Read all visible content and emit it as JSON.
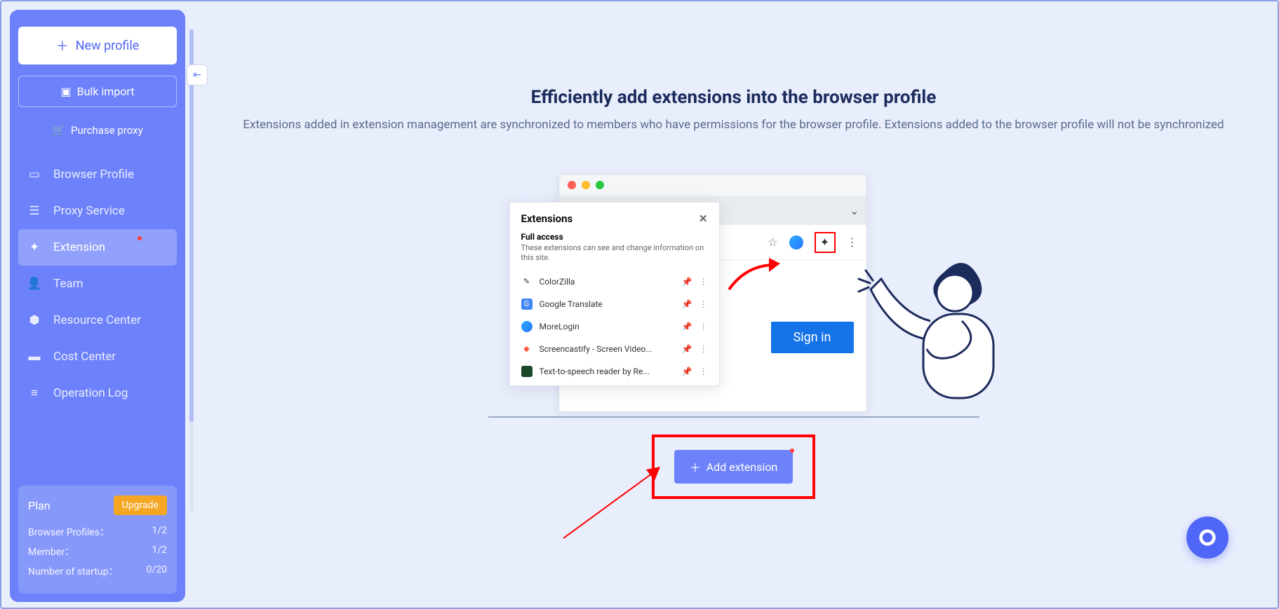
{
  "sidebar": {
    "new_profile": "New profile",
    "bulk_import": "Bulk import",
    "purchase_proxy": "Purchase proxy",
    "items": [
      {
        "label": "Browser Profile"
      },
      {
        "label": "Proxy Service"
      },
      {
        "label": "Extension"
      },
      {
        "label": "Team"
      },
      {
        "label": "Resource Center"
      },
      {
        "label": "Cost Center"
      },
      {
        "label": "Operation Log"
      }
    ],
    "plan": {
      "title": "Plan",
      "upgrade": "Upgrade",
      "profiles_label": "Browser Profiles：",
      "profiles_value": "1/2",
      "member_label": "Member：",
      "member_value": "1/2",
      "startup_label": "Number of startup：",
      "startup_value": "0/20"
    }
  },
  "main": {
    "title": "Efficiently add extensions into the browser profile",
    "subtitle": "Extensions added in extension management are synchronized to members who have permissions for the browser profile. Extensions added to the browser profile will not be synchronized",
    "add_extension": "Add extension",
    "signin": "Sign in"
  },
  "popup": {
    "title": "Extensions",
    "full_access": "Full access",
    "desc": "These extensions can see and change information on this site.",
    "items": [
      {
        "name": "ColorZilla",
        "color": "#333"
      },
      {
        "name": "Google Translate",
        "color": "#4285f4"
      },
      {
        "name": "MoreLogin",
        "color": "#2aa8ff"
      },
      {
        "name": "Screencastify - Screen Video...",
        "color": "#ff5a3c"
      },
      {
        "name": "Text-to-speech reader by Re...",
        "color": "#1a4a2a"
      }
    ]
  },
  "colors": {
    "traffic_red": "#ff5f57",
    "traffic_yellow": "#febc2e",
    "traffic_green": "#28c840"
  }
}
